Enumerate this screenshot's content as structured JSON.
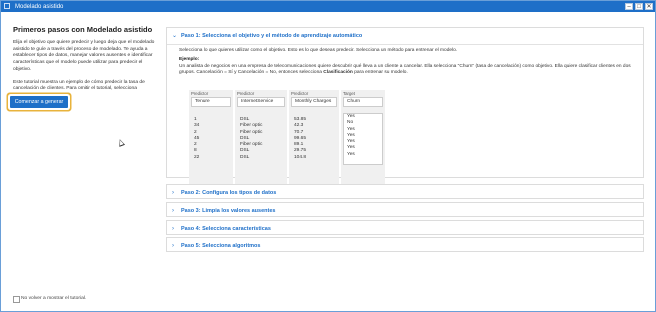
{
  "window": {
    "title": "Modelado asistido",
    "minimize": "–",
    "maximize": "□",
    "close": "✕"
  },
  "left": {
    "title": "Primeros pasos con Modelado asistido",
    "intro": "Elija el objetivo que quiere predecir y luego deja que el modelado asistido te guíe a través del proceso de modelado. Te ayuda a establecer tipos de datos, manejar valores ausentes e identificar características que el modelo puede utilizar para predecir el objetivo.",
    "tutorial_prefix": "Este tutorial muestra un ejemplo de cómo predecir la tasa de cancelación de clientes. Para omitir el tutorial, selecciona ",
    "tutorial_bold": "Comenzar a generar",
    "tutorial_suffix": ".",
    "start_button": "Comenzar a generar",
    "dont_show": "No volver a mostrar el tutorial."
  },
  "steps": [
    {
      "label": "Paso 1: Selecciona el objetivo y el método de aprendizaje automático",
      "expanded": true
    },
    {
      "label": "Paso 2: Configura los tipos de datos",
      "expanded": false
    },
    {
      "label": "Paso 3: Limpia los valores ausentes",
      "expanded": false
    },
    {
      "label": "Paso 4: Selecciona características",
      "expanded": false
    },
    {
      "label": "Paso 5: Selecciona algoritmos",
      "expanded": false
    }
  ],
  "step1": {
    "intro": "Selecciona lo que quieres utilizar como el objetivo. Esto es lo que deseas predecir. Selecciona un método para entrenar el modelo.",
    "example_label": "Ejemplo:",
    "example_text": "Un analista de negocios en una empresa de telecomunicaciones quiere descubrir qué lleva a un cliente a cancelar. Ella selecciona \"Churn\" (tasa de cancelación) como objetivo. Ella quiere clasificar clientes en dos grupos. Cancelación = Sí y Cancelación = No, entonces selecciona ",
    "example_bold": "Clasificación",
    "example_suffix": " para entrenar su modelo."
  },
  "table": {
    "columns": [
      {
        "group": "Predictor",
        "header": "Tenure",
        "values": [
          "1",
          "34",
          "2",
          "45",
          "2",
          "8",
          "22"
        ]
      },
      {
        "group": "Predictor",
        "header": "InternetService",
        "values": [
          "DSL",
          "Fiber optic",
          "Fiber optic",
          "DSL",
          "Fiber optic",
          "DSL",
          "DSL"
        ]
      },
      {
        "group": "Predictor",
        "header": "Monthly Charges",
        "values": [
          "53.85",
          "42.3",
          "70.7",
          "99.65",
          "89.1",
          "29.75",
          "104.8"
        ]
      },
      {
        "group": "Target",
        "header": "Churn",
        "values": [
          "Yes",
          "No",
          "Yes",
          "Yes",
          "Yes",
          "Yes",
          "Yes"
        ]
      }
    ]
  },
  "colors": {
    "accent": "#1e6fc8",
    "highlight": "#e8b33c"
  }
}
